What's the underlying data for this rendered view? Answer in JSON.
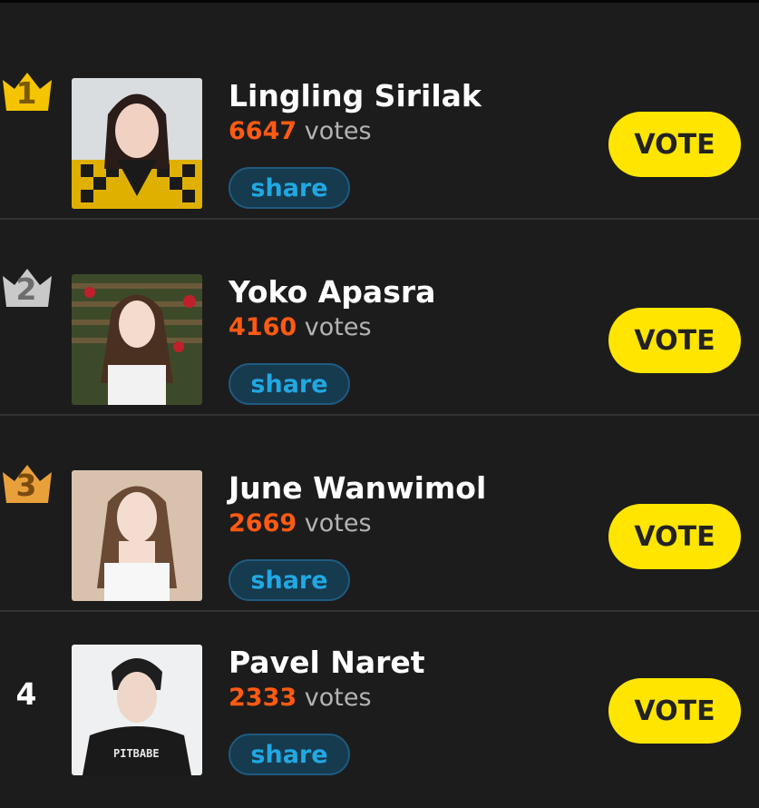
{
  "entries": [
    {
      "rank": "1",
      "name": "Lingling Sirilak",
      "votes": "6647",
      "votes_label": "votes",
      "share_label": "share",
      "vote_label": "VOTE",
      "crown_color": "#f5c400",
      "crown_text_color": "#7a5a00"
    },
    {
      "rank": "2",
      "name": "Yoko Apasra",
      "votes": "4160",
      "votes_label": "votes",
      "share_label": "share",
      "vote_label": "VOTE",
      "crown_color": "#c9c9c9",
      "crown_text_color": "#6d6d6d"
    },
    {
      "rank": "3",
      "name": "June Wanwimol",
      "votes": "2669",
      "votes_label": "votes",
      "share_label": "share",
      "vote_label": "VOTE",
      "crown_color": "#e8a13a",
      "crown_text_color": "#7a4a10"
    },
    {
      "rank": "4",
      "name": "Pavel Naret",
      "votes": "2333",
      "votes_label": "votes",
      "share_label": "share",
      "vote_label": "VOTE"
    }
  ],
  "colors": {
    "background": "#1c1c1c",
    "vote_count": "#ff5a12",
    "vote_button": "#ffe500",
    "share_text": "#21a8e2"
  }
}
